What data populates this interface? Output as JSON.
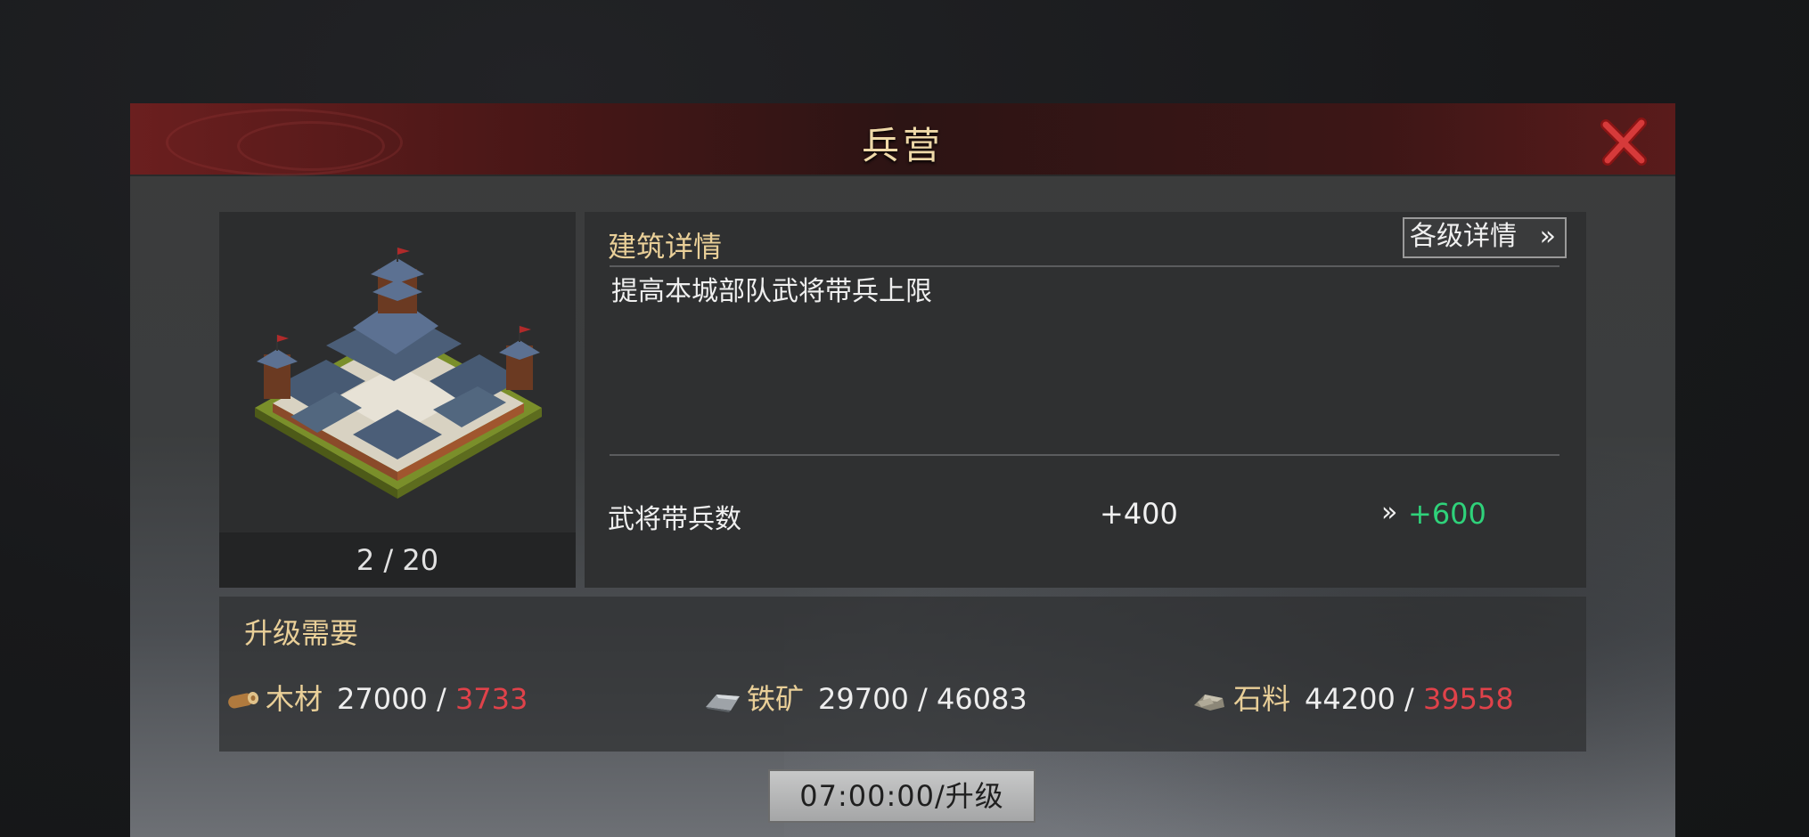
{
  "window": {
    "title": "兵营",
    "close_icon": "close-x-icon"
  },
  "building": {
    "image_icon": "barracks-building-image",
    "level_text": "2 / 20"
  },
  "details": {
    "section_title": "建筑详情",
    "levels_button_label": "各级详情",
    "levels_button_icon": "double-chevron-right-icon",
    "description": "提高本城部队武将带兵上限",
    "stat": {
      "label": "武将带兵数",
      "current": "+400",
      "arrow_icon": "double-chevron-right-icon",
      "next": "+600"
    }
  },
  "requirements": {
    "section_title": "升级需要",
    "resources": [
      {
        "icon": "wood-log-icon",
        "name": "木材",
        "need": "27000 /",
        "have": "3733",
        "sufficient": false
      },
      {
        "icon": "iron-ore-icon",
        "name": "铁矿",
        "need": "29700 /",
        "have": "46083",
        "sufficient": true
      },
      {
        "icon": "stone-icon",
        "name": "石料",
        "need": "44200 /",
        "have": "39558",
        "sufficient": false
      }
    ]
  },
  "upgrade_button": {
    "label": "07:00:00/升级"
  },
  "colors": {
    "accent_gold": "#e9cf98",
    "insufficient_red": "#e0424a",
    "increase_green": "#2fd27a",
    "header_red": "#6b1f1f"
  }
}
